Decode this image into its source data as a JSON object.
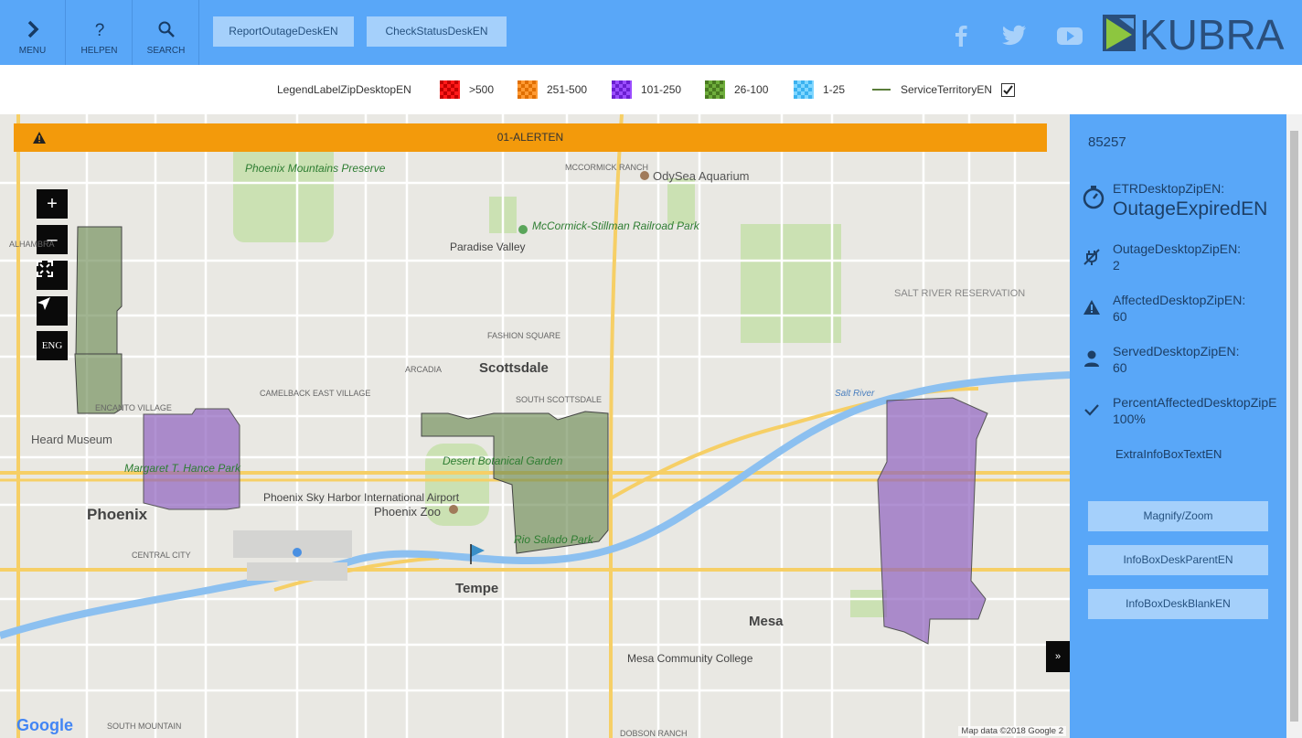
{
  "header": {
    "menu_label": "MENU",
    "help_label": "HELPEN",
    "search_label": "SEARCH",
    "report_button": "ReportOutageDeskEN",
    "status_button": "CheckStatusDeskEN",
    "logo_text": "KUBRA",
    "social": [
      "facebook-icon",
      "twitter-icon",
      "youtube-icon"
    ]
  },
  "legend": {
    "title": "LegendLabelZipDesktopEN",
    "items": [
      {
        "label": ">500",
        "color": "#ff1a1a"
      },
      {
        "label": "251-500",
        "color": "#ff8c1a"
      },
      {
        "label": "101-250",
        "color": "#8a2be2"
      },
      {
        "label": "26-100",
        "color": "#5f9e2f"
      },
      {
        "label": "1-25",
        "color": "#5cc8ff"
      }
    ],
    "territory_label": "ServiceTerritoryEN",
    "territory_checked": true
  },
  "map": {
    "alert_text": "01-ALERTEN",
    "zoom_in": "+",
    "zoom_out": "–",
    "lang_button": "ENG",
    "expand_button": "»",
    "attribution": "Map data ©2018 Google",
    "scale": "2",
    "google": "Google",
    "cities": [
      "Phoenix",
      "Scottsdale",
      "Tempe",
      "Mesa"
    ],
    "places": [
      "Paradise Valley",
      "Phoenix Mountains Preserve",
      "McCormick-Stillman Railroad Park",
      "OdySea Aquarium",
      "Heard Museum",
      "Margaret T. Hance Park",
      "Phoenix Sky Harbor International Airport",
      "Phoenix Zoo",
      "Desert Botanical Garden",
      "Rio Salado Park",
      "Mesa Community College",
      "SALT RIVER RESERVATION",
      "CAMELBACK EAST VILLAGE",
      "ENCANTO VILLAGE",
      "ARCADIA",
      "FASHION SQUARE",
      "SOUTH SCOTTSDALE",
      "CENTRAL CITY",
      "Salt River",
      "SOUTH MOUNTAIN",
      "DOBSON RANCH",
      "MCCORMICK RANCH",
      "ALHAMBRA"
    ]
  },
  "sidebar": {
    "zip": "85257",
    "etr_label": "ETRDesktopZipEN:",
    "etr_value": "OutageExpiredEN",
    "outage_label": "OutageDesktopZipEN:",
    "outage_value": "2",
    "affected_label": "AffectedDesktopZipEN:",
    "affected_value": "60",
    "served_label": "ServedDesktopZipEN:",
    "served_value": "60",
    "percent_label": "PercentAffectedDesktopZipE",
    "percent_value": "100%",
    "extra": "ExtraInfoBoxTextEN",
    "btn_zoom": "Magnify/Zoom",
    "btn_parent": "InfoBoxDeskParentEN",
    "btn_blank": "InfoBoxDeskBlankEN"
  }
}
